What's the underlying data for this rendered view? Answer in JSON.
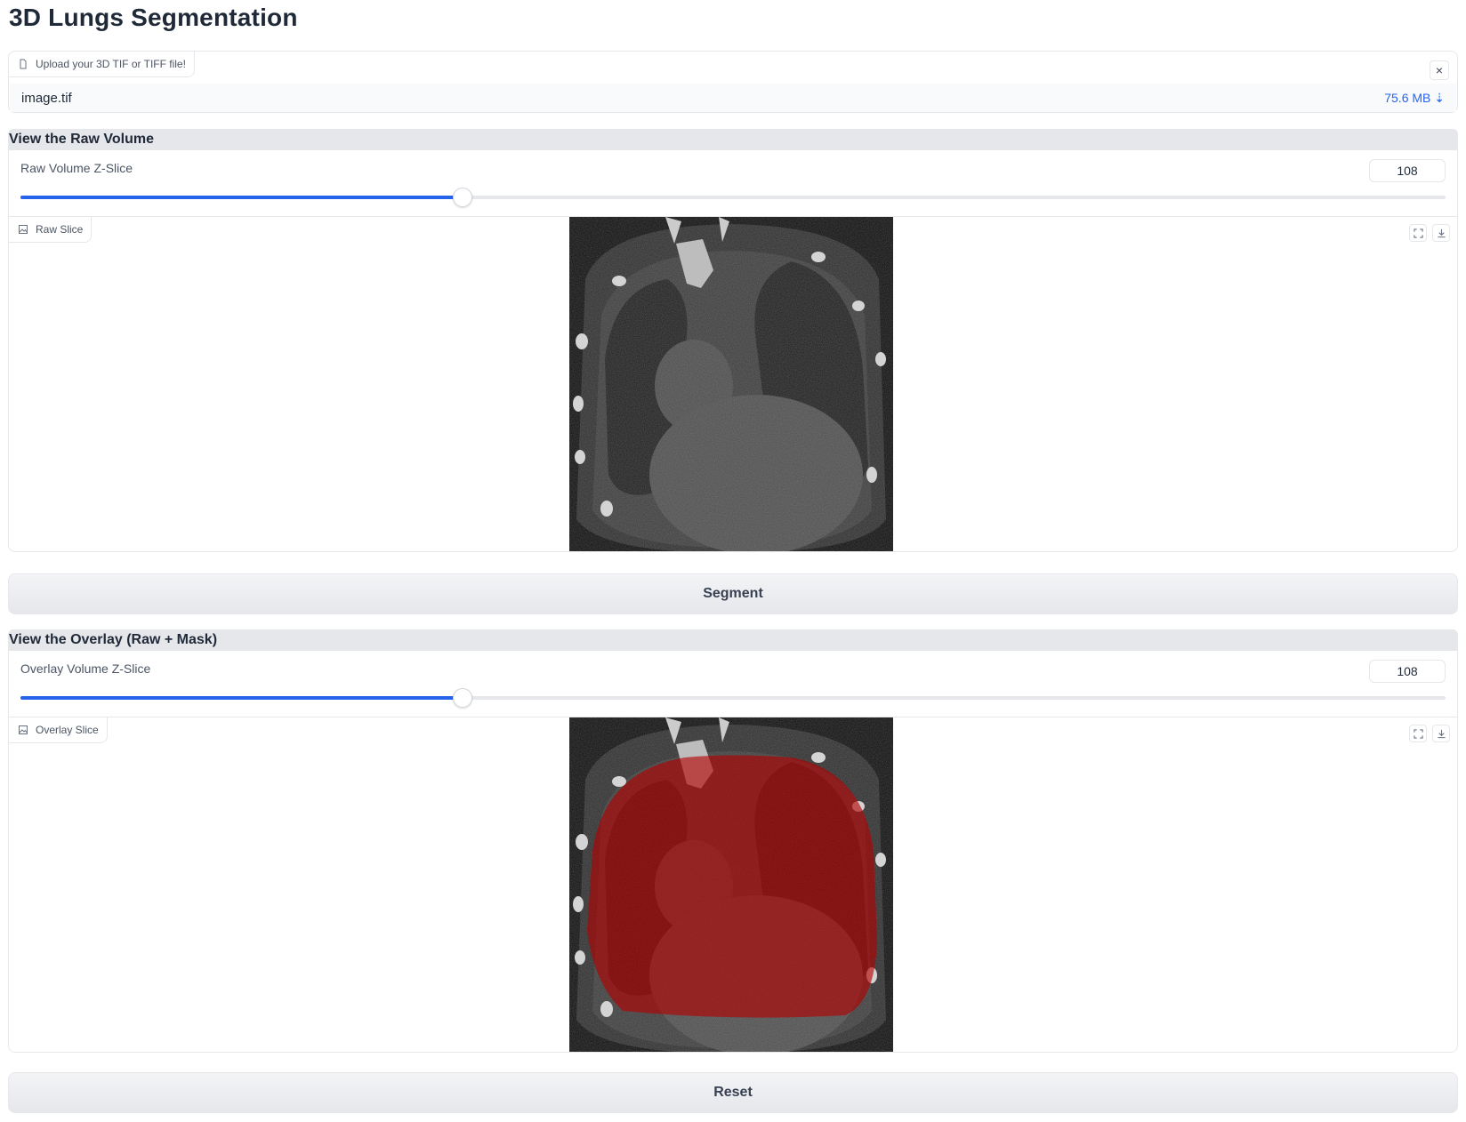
{
  "app": {
    "title": "3D Lungs Segmentation"
  },
  "upload": {
    "label": "Upload your 3D TIF or TIFF file!",
    "file_name": "image.tif",
    "file_size": "75.6 MB ⇣",
    "close_glyph": "×"
  },
  "raw": {
    "section_title": "View the Raw Volume",
    "slider_label": "Raw Volume Z-Slice",
    "slice_value": "108",
    "slider_fraction": 0.31,
    "image_label": "Raw Slice"
  },
  "segment_button": "Segment",
  "overlay": {
    "section_title": "View the Overlay (Raw + Mask)",
    "slider_label": "Overlay Volume Z-Slice",
    "slice_value": "108",
    "slider_fraction": 0.31,
    "image_label": "Overlay Slice",
    "mask_color": "#b40000"
  },
  "reset_button": "Reset",
  "colors": {
    "accent": "#2563eb",
    "filesize_link": "#2563eb"
  }
}
